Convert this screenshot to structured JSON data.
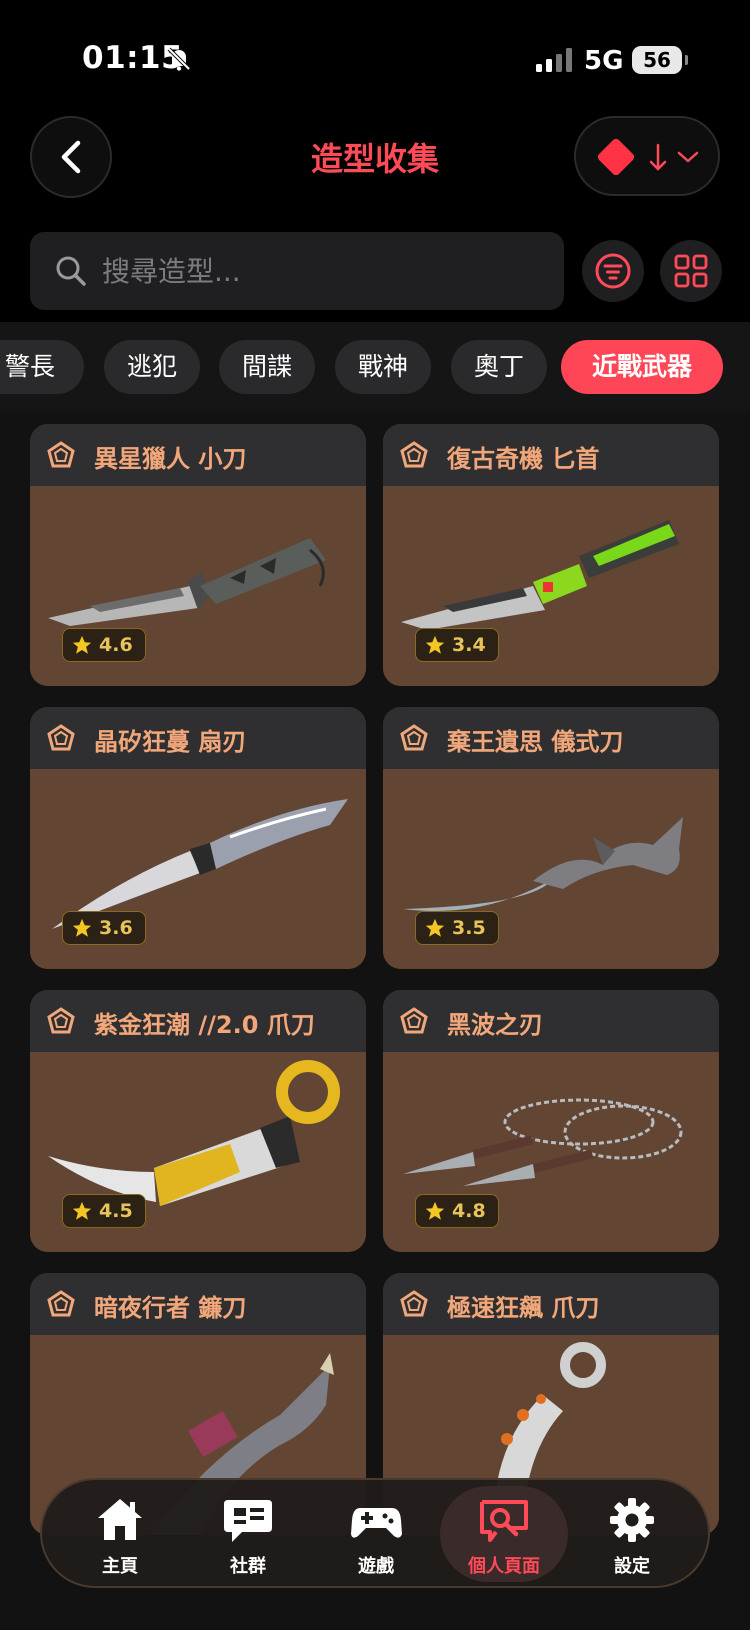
{
  "status_bar": {
    "time": "01:15",
    "network": "5G",
    "battery": "56"
  },
  "header": {
    "title": "造型收集"
  },
  "search": {
    "placeholder": "搜尋造型..."
  },
  "categories": [
    {
      "label": "警長",
      "active": false
    },
    {
      "label": "逃犯",
      "active": false
    },
    {
      "label": "間諜",
      "active": false
    },
    {
      "label": "戰神",
      "active": false
    },
    {
      "label": "奧丁",
      "active": false
    },
    {
      "label": "近戰武器",
      "active": true
    }
  ],
  "skins": [
    {
      "name": "異星獵人 小刀",
      "rating": "4.6"
    },
    {
      "name": "復古奇機 匕首",
      "rating": "3.4"
    },
    {
      "name": "晶矽狂蔓 扇刃",
      "rating": "3.6"
    },
    {
      "name": "棄王遺思 儀式刀",
      "rating": "3.5"
    },
    {
      "name": "紫金狂潮 //2.0 爪刀",
      "rating": "4.5"
    },
    {
      "name": "黑波之刃",
      "rating": "4.8"
    },
    {
      "name": "暗夜行者 鐮刀",
      "rating": ""
    },
    {
      "name": "極速狂飆 爪刀",
      "rating": ""
    }
  ],
  "nav": [
    {
      "label": "主頁",
      "icon": "home-icon",
      "active": false
    },
    {
      "label": "社群",
      "icon": "chat-icon",
      "active": false
    },
    {
      "label": "遊戲",
      "icon": "gamepad-icon",
      "active": false
    },
    {
      "label": "個人頁面",
      "icon": "profile-search-icon",
      "active": true
    },
    {
      "label": "設定",
      "icon": "gear-icon",
      "active": false
    }
  ],
  "colors": {
    "accent": "#ff4a58",
    "card_bg": "#634533",
    "card_title": "#f2a77a",
    "rating": "#e8c35a"
  }
}
